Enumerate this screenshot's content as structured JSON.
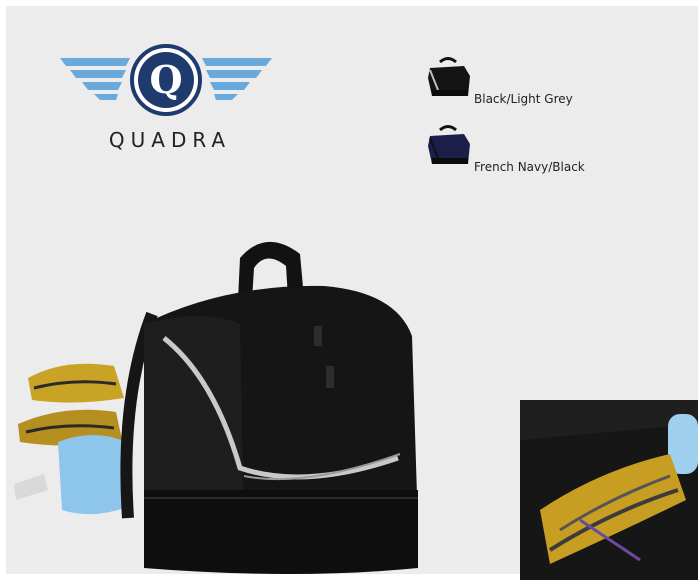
{
  "brand": {
    "name": "QUADRA",
    "logo_letter": "Q"
  },
  "colourways": [
    {
      "label": "Black/Light Grey",
      "icon": "bag-black-light-grey-icon"
    },
    {
      "label": "French Navy/Black",
      "icon": "bag-french-navy-black-icon"
    }
  ],
  "colors": {
    "background": "#ececec",
    "logo_blue": "#6aa9dc",
    "logo_navy": "#1f3a6d",
    "bag_black": "#141414",
    "trim_grey": "#c9c9c9"
  }
}
